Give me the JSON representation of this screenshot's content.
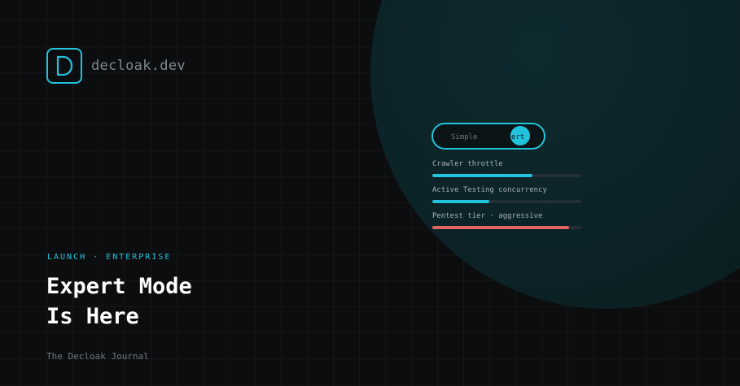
{
  "brand": {
    "logo_letter": "D",
    "name": "decloak.dev",
    "accent_color": "#22c3dc"
  },
  "mode_toggle": {
    "options": [
      "Simple",
      "Expert"
    ],
    "visible_labels": [
      "Simple",
      "ert"
    ],
    "selected": "Expert"
  },
  "meters": [
    {
      "label": "Crawler throttle",
      "level": 0.67,
      "color": "#22c3dc"
    },
    {
      "label": "Active Testing concurrency",
      "level": 0.38,
      "color": "#22c3dc"
    },
    {
      "label": "Pentest tier · aggressive",
      "level": 0.92,
      "color": "#e06461"
    }
  ],
  "hero": {
    "kicker": "LAUNCH · ENTERPRISE",
    "title_line1": "Expert Mode",
    "title_line2": "Is Here",
    "byline": "The Decloak Journal"
  }
}
